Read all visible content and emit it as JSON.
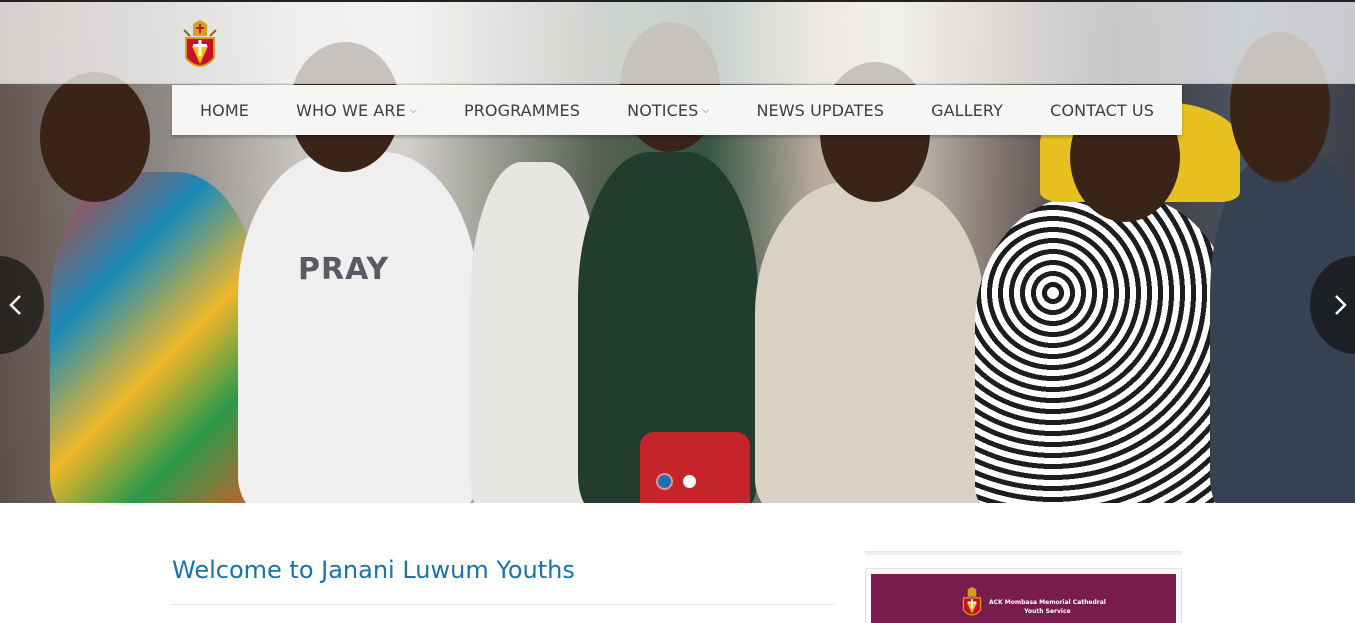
{
  "brand": {
    "logo_icon": "cathedral-crest-icon"
  },
  "nav": {
    "items": [
      {
        "label": "HOME",
        "has_dropdown": false
      },
      {
        "label": "WHO WE ARE",
        "has_dropdown": true
      },
      {
        "label": "PROGRAMMES",
        "has_dropdown": false
      },
      {
        "label": "NOTICES",
        "has_dropdown": true
      },
      {
        "label": "NEWS UPDATES",
        "has_dropdown": false
      },
      {
        "label": "GALLERY",
        "has_dropdown": false
      },
      {
        "label": "CONTACT US",
        "has_dropdown": false
      }
    ],
    "dropdown_icon": "chevron-down-icon"
  },
  "slider": {
    "prev_icon": "chevron-left-icon",
    "next_icon": "chevron-right-icon",
    "slide_count": 2,
    "active_slide": 1,
    "shirt_text": "PRAY"
  },
  "main": {
    "welcome_title": "Welcome to Janani Luwum Youths"
  },
  "sidebar": {
    "banner_title_line1": "ACK Mombasa Memorial Cathedral",
    "banner_title_line2": "Youth Service"
  },
  "colors": {
    "accent": "#1a73a8",
    "active_dot": "#1f6fb0",
    "banner_bg": "#7a1b4e"
  }
}
